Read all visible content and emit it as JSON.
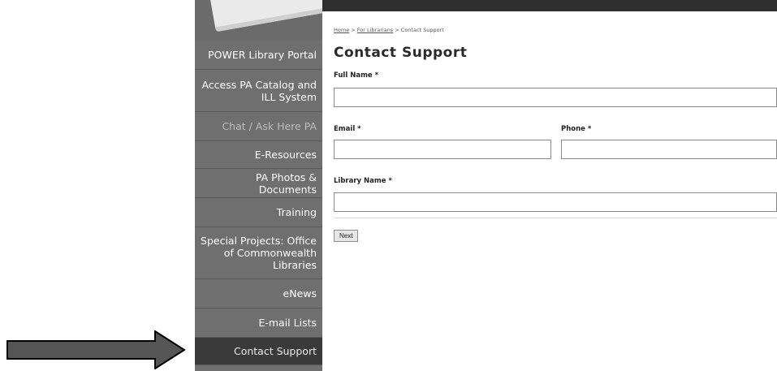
{
  "sidebar": {
    "items": [
      {
        "label": "POWER Library Portal",
        "state": "normal"
      },
      {
        "label": "Access PA Catalog and ILL System",
        "state": "normal"
      },
      {
        "label": "Chat / Ask Here PA",
        "state": "muted"
      },
      {
        "label": "E-Resources",
        "state": "normal"
      },
      {
        "label": "PA Photos & Documents",
        "state": "normal"
      },
      {
        "label": "Training",
        "state": "normal"
      },
      {
        "label": "Special Projects: Office of Commonwealth Libraries",
        "state": "normal"
      },
      {
        "label": "eNews",
        "state": "normal"
      },
      {
        "label": "E-mail Lists",
        "state": "normal"
      },
      {
        "label": "Contact Support",
        "state": "active"
      }
    ]
  },
  "breadcrumb": {
    "home": "Home",
    "sep1": " > ",
    "for_librarians": "For Librarians",
    "sep2": " > ",
    "current": "Contact Support"
  },
  "page": {
    "title": "Contact Support"
  },
  "form": {
    "full_name_label": "Full Name *",
    "email_label": "Email *",
    "phone_label": "Phone *",
    "library_name_label": "Library Name *",
    "full_name_value": "",
    "email_value": "",
    "phone_value": "",
    "library_name_value": "",
    "next_button": "Next"
  },
  "colors": {
    "sidebar_bg": "#6f6f6f",
    "active_item_bg": "#3a3a3a",
    "top_bar": "#2f2f2f",
    "arrow_fill": "#555555"
  },
  "annotation": {
    "arrow_icon": "right-arrow-icon"
  }
}
